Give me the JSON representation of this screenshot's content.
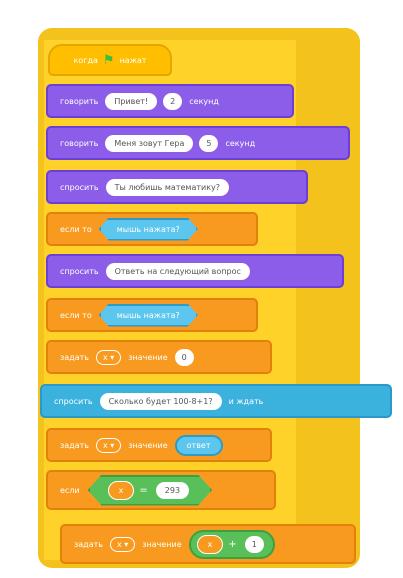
{
  "hat": {
    "prefix": "когда",
    "flag": "⚑",
    "suffix": "нажат"
  },
  "blocks": [
    {
      "label": "говорить",
      "value": "Привет!",
      "num": "2",
      "suffix": "секунд"
    },
    {
      "label": "говорить",
      "value": "Меня зовут Гера",
      "num": "5",
      "suffix": "секунд"
    },
    {
      "label": "спросить",
      "value": "Ты любишь математику?"
    },
    {
      "label": "если то",
      "sensor": "мышь нажата?"
    },
    {
      "label": "спросить",
      "value": "Ответь на следующий вопрос"
    },
    {
      "label": "если то",
      "sensor": "мышь нажата?"
    },
    {
      "label": "задать",
      "var": "x",
      "mid": "значение",
      "value": "0"
    },
    {
      "label": "спросить",
      "value": "Сколько будет 100-8+1?",
      "suffix": "и ждать"
    },
    {
      "label": "задать",
      "var": "x",
      "mid": "значение",
      "reporter": "ответ"
    },
    {
      "label": "если",
      "left": "x",
      "op": "=",
      "right": "293"
    },
    {
      "label": "задать",
      "var": "x",
      "mid": "значение",
      "left": "x",
      "op": "+",
      "right": "1"
    }
  ]
}
